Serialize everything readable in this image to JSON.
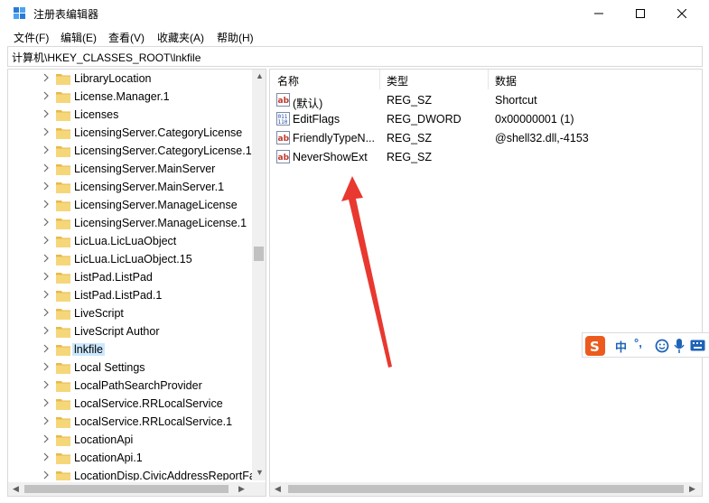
{
  "window": {
    "title": "注册表编辑器",
    "controls": {
      "minimize": "—",
      "maximize": "☐",
      "close": "✕"
    }
  },
  "menu": [
    "文件(F)",
    "编辑(E)",
    "查看(V)",
    "收藏夹(A)",
    "帮助(H)"
  ],
  "address": "计算机\\HKEY_CLASSES_ROOT\\lnkfile",
  "tree": {
    "items": [
      "LibraryLocation",
      "License.Manager.1",
      "Licenses",
      "LicensingServer.CategoryLicense",
      "LicensingServer.CategoryLicense.1",
      "LicensingServer.MainServer",
      "LicensingServer.MainServer.1",
      "LicensingServer.ManageLicense",
      "LicensingServer.ManageLicense.1",
      "LicLua.LicLuaObject",
      "LicLua.LicLuaObject.15",
      "ListPad.ListPad",
      "ListPad.ListPad.1",
      "LiveScript",
      "LiveScript Author",
      "lnkfile",
      "Local Settings",
      "LocalPathSearchProvider",
      "LocalService.RRLocalService",
      "LocalService.RRLocalService.1",
      "LocationApi",
      "LocationApi.1",
      "LocationDisp.CivicAddressReportFactory"
    ],
    "selected": "lnkfile"
  },
  "list": {
    "columns": {
      "name": "名称",
      "type": "类型",
      "data": "数据"
    },
    "rows": [
      {
        "name": "(默认)",
        "type": "REG_SZ",
        "data": "Shortcut",
        "icon": "string-value-icon"
      },
      {
        "name": "EditFlags",
        "type": "REG_DWORD",
        "data": "0x00000001 (1)",
        "icon": "binary-value-icon"
      },
      {
        "name": "FriendlyTypeN...",
        "type": "REG_SZ",
        "data": "@shell32.dll,-4153",
        "icon": "string-value-icon"
      },
      {
        "name": "NeverShowExt",
        "type": "REG_SZ",
        "data": "",
        "icon": "string-value-icon"
      }
    ]
  },
  "ime": {
    "mode": "中",
    "punct": "°,"
  },
  "colors": {
    "selection": "#cce8ff",
    "folder": "#f5d77a",
    "arrow": "#e8382f",
    "ime_accent": "#1e63b8"
  }
}
